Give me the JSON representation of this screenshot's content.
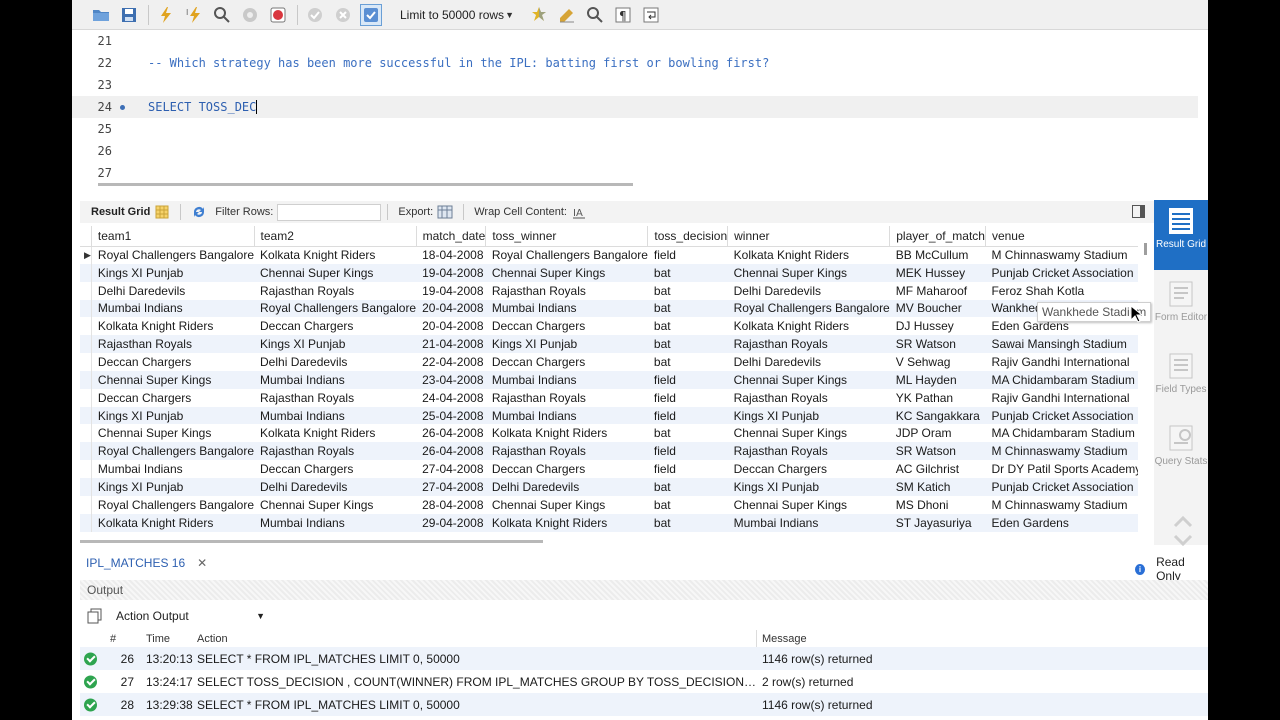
{
  "toolbar": {
    "limit_label": "Limit to 50000 rows",
    "icons": [
      "open-folder-icon",
      "save-icon",
      "execute-icon",
      "execute-current-icon",
      "explain-icon",
      "stop-icon",
      "toggle-error-icon",
      "commit-icon",
      "rollback-icon",
      "autocommit-icon",
      "limit-select",
      "beautify-icon",
      "format-icon",
      "find-icon",
      "invisible-chars-icon",
      "wrap-icon"
    ]
  },
  "editor": {
    "lines": [
      {
        "num": "21",
        "text": "",
        "type": "plain"
      },
      {
        "num": "22",
        "text": "-- Which strategy has been more successful in the IPL: batting first or bowling first?",
        "type": "comment"
      },
      {
        "num": "23",
        "text": "",
        "type": "plain"
      },
      {
        "num": "24",
        "text": "SELECT TOSS_DEC",
        "type": "kw",
        "current": true
      },
      {
        "num": "25",
        "text": "",
        "type": "plain"
      },
      {
        "num": "26",
        "text": "",
        "type": "plain"
      },
      {
        "num": "27",
        "text": "",
        "type": "plain"
      }
    ]
  },
  "result_toolbar": {
    "result_grid": "Result Grid",
    "filter_rows": "Filter Rows:",
    "export": "Export:",
    "wrap_cell": "Wrap Cell Content:"
  },
  "grid": {
    "columns": [
      "team1",
      "team2",
      "match_date",
      "toss_winner",
      "toss_decision",
      "winner",
      "player_of_match",
      "venue"
    ],
    "rows": [
      [
        "Royal Challengers Bangalore",
        "Kolkata Knight Riders",
        "18-04-2008",
        "Royal Challengers Bangalore",
        "field",
        "Kolkata Knight Riders",
        "BB McCullum",
        "M Chinnaswamy Stadium"
      ],
      [
        "Kings XI Punjab",
        "Chennai Super Kings",
        "19-04-2008",
        "Chennai Super Kings",
        "bat",
        "Chennai Super Kings",
        "MEK Hussey",
        "Punjab Cricket Association"
      ],
      [
        "Delhi Daredevils",
        "Rajasthan Royals",
        "19-04-2008",
        "Rajasthan Royals",
        "bat",
        "Delhi Daredevils",
        "MF Maharoof",
        "Feroz Shah Kotla"
      ],
      [
        "Mumbai Indians",
        "Royal Challengers Bangalore",
        "20-04-2008",
        "Mumbai Indians",
        "bat",
        "Royal Challengers Bangalore",
        "MV Boucher",
        "Wankhede Stadium"
      ],
      [
        "Kolkata Knight Riders",
        "Deccan Chargers",
        "20-04-2008",
        "Deccan Chargers",
        "bat",
        "Kolkata Knight Riders",
        "DJ Hussey",
        "Eden Gardens"
      ],
      [
        "Rajasthan Royals",
        "Kings XI Punjab",
        "21-04-2008",
        "Kings XI Punjab",
        "bat",
        "Rajasthan Royals",
        "SR Watson",
        "Sawai Mansingh Stadium"
      ],
      [
        "Deccan Chargers",
        "Delhi Daredevils",
        "22-04-2008",
        "Deccan Chargers",
        "bat",
        "Delhi Daredevils",
        "V Sehwag",
        "Rajiv Gandhi International"
      ],
      [
        "Chennai Super Kings",
        "Mumbai Indians",
        "23-04-2008",
        "Mumbai Indians",
        "field",
        "Chennai Super Kings",
        "ML Hayden",
        "MA Chidambaram Stadium"
      ],
      [
        "Deccan Chargers",
        "Rajasthan Royals",
        "24-04-2008",
        "Rajasthan Royals",
        "field",
        "Rajasthan Royals",
        "YK Pathan",
        "Rajiv Gandhi International"
      ],
      [
        "Kings XI Punjab",
        "Mumbai Indians",
        "25-04-2008",
        "Mumbai Indians",
        "field",
        "Kings XI Punjab",
        "KC Sangakkara",
        "Punjab Cricket Association"
      ],
      [
        "Chennai Super Kings",
        "Kolkata Knight Riders",
        "26-04-2008",
        "Kolkata Knight Riders",
        "bat",
        "Chennai Super Kings",
        "JDP Oram",
        "MA Chidambaram Stadium"
      ],
      [
        "Royal Challengers Bangalore",
        "Rajasthan Royals",
        "26-04-2008",
        "Rajasthan Royals",
        "field",
        "Rajasthan Royals",
        "SR Watson",
        "M Chinnaswamy Stadium"
      ],
      [
        "Mumbai Indians",
        "Deccan Chargers",
        "27-04-2008",
        "Deccan Chargers",
        "field",
        "Deccan Chargers",
        "AC Gilchrist",
        "Dr DY Patil Sports Academy"
      ],
      [
        "Kings XI Punjab",
        "Delhi Daredevils",
        "27-04-2008",
        "Delhi Daredevils",
        "bat",
        "Kings XI Punjab",
        "SM Katich",
        "Punjab Cricket Association"
      ],
      [
        "Royal Challengers Bangalore",
        "Chennai Super Kings",
        "28-04-2008",
        "Chennai Super Kings",
        "bat",
        "Chennai Super Kings",
        "MS Dhoni",
        "M Chinnaswamy Stadium"
      ],
      [
        "Kolkata Knight Riders",
        "Mumbai Indians",
        "29-04-2008",
        "Kolkata Knight Riders",
        "bat",
        "Mumbai Indians",
        "ST Jayasuriya",
        "Eden Gardens"
      ]
    ],
    "tooltip": "Wankhede Stadium"
  },
  "side_panel": [
    {
      "label": "Result Grid",
      "active": true
    },
    {
      "label": "Form Editor",
      "active": false
    },
    {
      "label": "Field Types",
      "active": false
    },
    {
      "label": "Query Stats",
      "active": false
    }
  ],
  "tab": {
    "label": "IPL_MATCHES 16",
    "close": "✕"
  },
  "read_only": "Read Only",
  "output": {
    "header": "Output",
    "selector": "Action Output",
    "columns": {
      "num": "#",
      "time": "Time",
      "action": "Action",
      "message": "Message"
    },
    "rows": [
      {
        "num": "26",
        "time": "13:20:13",
        "action": "SELECT * FROM IPL_MATCHES LIMIT 0, 50000",
        "message": "1146 row(s) returned"
      },
      {
        "num": "27",
        "time": "13:24:17",
        "action": "SELECT TOSS_DECISION , COUNT(WINNER) FROM IPL_MATCHES GROUP BY TOSS_DECISION LIMIT...",
        "message": "2 row(s) returned"
      },
      {
        "num": "28",
        "time": "13:29:38",
        "action": "SELECT * FROM IPL_MATCHES LIMIT 0, 50000",
        "message": "1146 row(s) returned"
      }
    ]
  },
  "colors": {
    "accent": "#1f6fc5",
    "comment": "#3b6fc1",
    "ok": "#2ea44f",
    "row_alt": "#eef3fb"
  }
}
